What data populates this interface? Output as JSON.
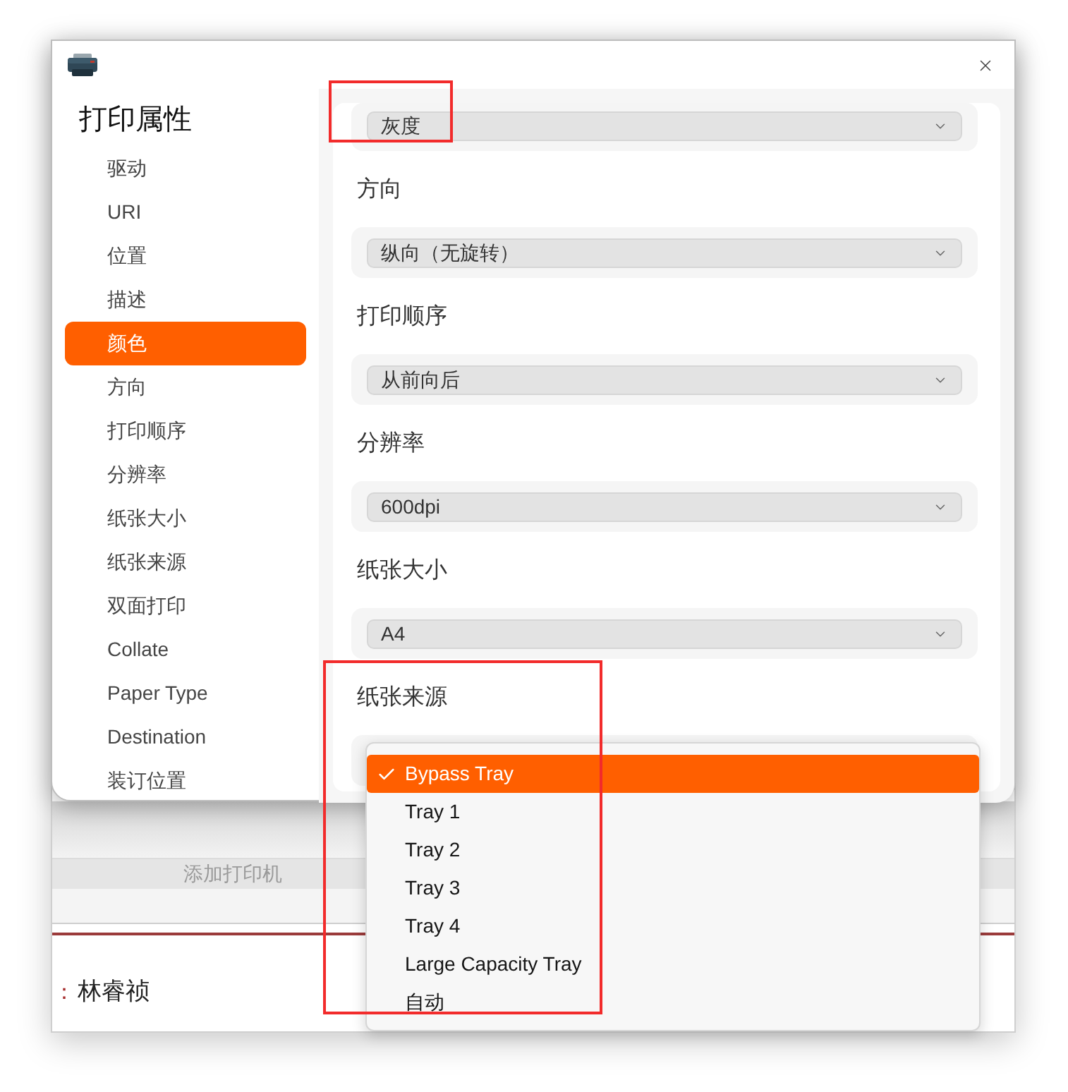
{
  "dialog": {
    "heading": "打印属性",
    "nav": [
      {
        "label": "驱动",
        "selected": false
      },
      {
        "label": "URI",
        "selected": false
      },
      {
        "label": "位置",
        "selected": false
      },
      {
        "label": "描述",
        "selected": false
      },
      {
        "label": "颜色",
        "selected": true
      },
      {
        "label": "方向",
        "selected": false
      },
      {
        "label": "打印顺序",
        "selected": false
      },
      {
        "label": "分辨率",
        "selected": false
      },
      {
        "label": "纸张大小",
        "selected": false
      },
      {
        "label": "纸张来源",
        "selected": false
      },
      {
        "label": "双面打印",
        "selected": false
      },
      {
        "label": "Collate",
        "selected": false
      },
      {
        "label": "Paper Type",
        "selected": false
      },
      {
        "label": "Destination",
        "selected": false
      },
      {
        "label": "装订位置",
        "selected": false
      }
    ]
  },
  "settings": [
    {
      "value": "灰度",
      "expanded": false
    },
    {
      "label": "方向",
      "value": "纵向（无旋转）",
      "expanded": false
    },
    {
      "label": "打印顺序",
      "value": "从前向后",
      "expanded": false
    },
    {
      "label": "分辨率",
      "value": "600dpi",
      "expanded": false
    },
    {
      "label": "纸张大小",
      "value": "A4",
      "expanded": false
    },
    {
      "label": "纸张来源",
      "expanded": true,
      "options": [
        {
          "label": "Bypass Tray",
          "selected": true
        },
        {
          "label": "Tray 1",
          "selected": false
        },
        {
          "label": "Tray 2",
          "selected": false
        },
        {
          "label": "Tray 3",
          "selected": false
        },
        {
          "label": "Tray 4",
          "selected": false
        },
        {
          "label": "Large Capacity Tray",
          "selected": false
        },
        {
          "label": "自动",
          "selected": false
        }
      ]
    }
  ],
  "background_window": {
    "button": "添加打印机",
    "owner": {
      "label": "：",
      "value": "林睿祯"
    }
  }
}
